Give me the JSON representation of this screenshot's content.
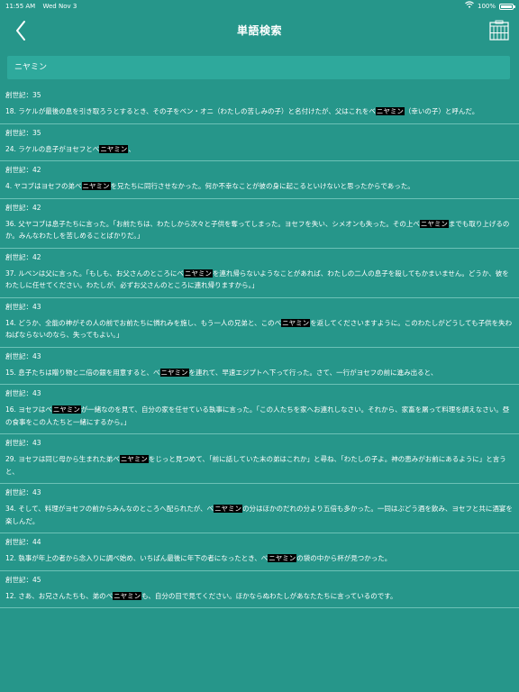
{
  "status_bar": {
    "time": "11:55 AM",
    "date": "Wed Nov 3",
    "battery_percent": "100%",
    "battery_level": 1.0,
    "icons": [
      "wifi-icon",
      "battery-icon"
    ]
  },
  "nav": {
    "title": "単語検索",
    "back_icon": "chevron-left-icon",
    "book_icon": "bookshelf-icon"
  },
  "search": {
    "query": "ニヤミン"
  },
  "colors": {
    "background": "#26968a",
    "search_box": "#2ea99c",
    "divider": "#6cc1b6",
    "highlight_bg": "#000000",
    "text": "#ffffff"
  },
  "results": [
    {
      "ref": "創世記：35",
      "pre": "18. ラケルが最後の息を引き取ろうとするとき、その子をベン・オニ（わたしの苦しみの子）と名付けたが、父はこれをベ",
      "match": "ニヤミン",
      "post": "（幸いの子）と呼んだ。"
    },
    {
      "ref": "創世記：35",
      "pre": "24. ラケルの息子がヨセフとベ",
      "match": "ニヤミン",
      "post": "、"
    },
    {
      "ref": "創世記：42",
      "pre": "4. ヤコブはヨセフの弟ベ",
      "match": "ニヤミン",
      "post": "を兄たちに同行させなかった。何か不幸なことが彼の身に起こるといけないと思ったからであった。"
    },
    {
      "ref": "創世記：42",
      "pre": "36. 父ヤコブは息子たちに言った。「お前たちは、わたしから次々と子供を奪ってしまった。ヨセフを失い、シメオンも失った。その上ベ",
      "match": "ニヤミン",
      "post": "までも取り上げるのか。みんなわたしを苦しめることばかりだ。」"
    },
    {
      "ref": "創世記：42",
      "pre": "37. ルベンは父に言った。「もしも、お父さんのところにベ",
      "match": "ニヤミン",
      "post": "を連れ帰らないようなことがあれば、わたしの二人の息子を殺してもかまいません。どうか、彼をわたしに任せてください。わたしが、必ずお父さんのところに連れ帰りますから。」"
    },
    {
      "ref": "創世記：43",
      "pre": "14. どうか、全能の神がその人の前でお前たちに憐れみを施し、もう一人の兄弟と、このベ",
      "match": "ニヤミン",
      "post": "を返してくださいますように。このわたしがどうしても子供を失わねばならないのなら、失ってもよい。」"
    },
    {
      "ref": "創世記：43",
      "pre": "15. 息子たちは贈り物と二倍の銀を用意すると、ベ",
      "match": "ニヤミン",
      "post": "を連れて、早速エジプトへ下って行った。さて、一行がヨセフの前に進み出ると、"
    },
    {
      "ref": "創世記：43",
      "pre": "16. ヨセフはベ",
      "match": "ニヤミン",
      "post": "が一緒なのを見て、自分の家を任せている執事に言った。「この人たちを家へお連れしなさい。それから、家畜を屠って料理を調えなさい。昼の食事をこの人たちと一緒にするから。」"
    },
    {
      "ref": "創世記：43",
      "pre": "29. ヨセフは同じ母から生まれた弟ベ",
      "match": "ニヤミン",
      "post": "をじっと見つめて、「前に話していた末の弟はこれか」と尋ね、「わたしの子よ。神の恵みがお前にあるように」と言うと、"
    },
    {
      "ref": "創世記：43",
      "pre": "34. そして、料理がヨセフの前からみんなのところへ配られたが、ベ",
      "match": "ニヤミン",
      "post": "の分はほかのだれの分より五倍も多かった。一同はぶどう酒を飲み、ヨセフと共に酒宴を楽しんだ。"
    },
    {
      "ref": "創世記：44",
      "pre": "12. 執事が年上の者から念入りに調べ始め、いちばん最後に年下の者になったとき、ベ",
      "match": "ニヤミン",
      "post": "の袋の中から杯が見つかった。"
    },
    {
      "ref": "創世記：45",
      "pre": "12. さあ、お兄さんたちも、弟のベ",
      "match": "ニヤミン",
      "post": "も、自分の目で見てください。ほかならぬわたしがあなたたちに言っているのです。"
    }
  ]
}
